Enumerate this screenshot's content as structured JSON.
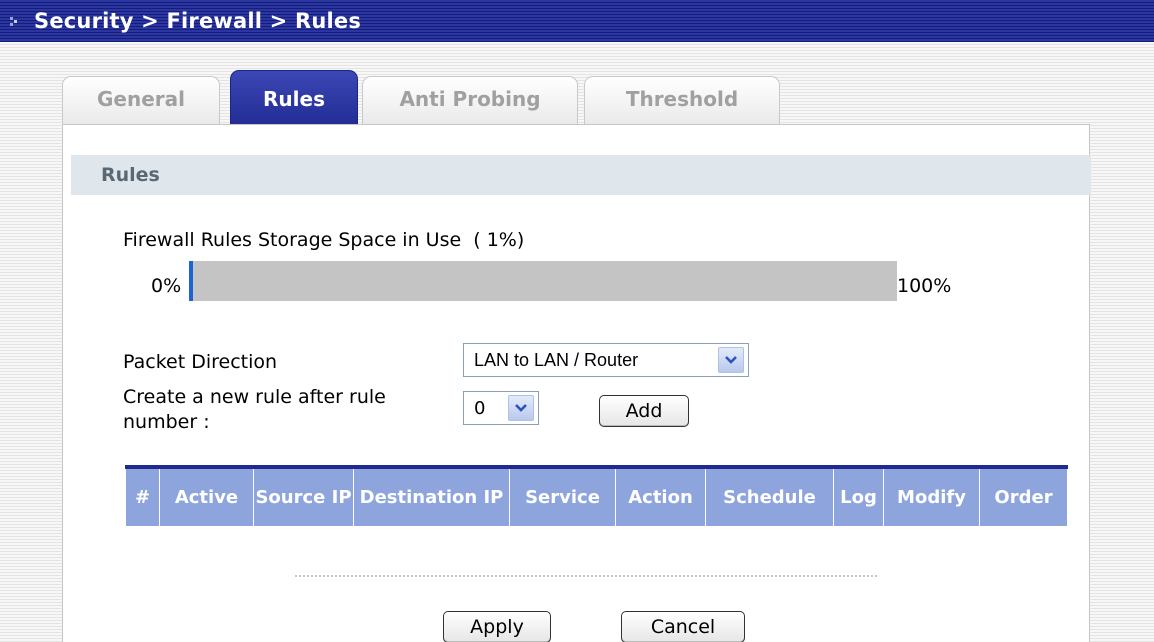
{
  "header": {
    "breadcrumb": "Security > Firewall > Rules"
  },
  "tabs": [
    {
      "label": "General",
      "active": false
    },
    {
      "label": "Rules",
      "active": true
    },
    {
      "label": "Anti Probing",
      "active": false
    },
    {
      "label": "Threshold",
      "active": false
    }
  ],
  "section": {
    "title": "Rules"
  },
  "storage": {
    "label": "Firewall Rules Storage Space in Use  ( 1%)",
    "min_label": "0%",
    "max_label": "100%",
    "used_percent": 1,
    "fill_color": "#1b63d8"
  },
  "form": {
    "packet_direction_label": "Packet Direction",
    "packet_direction_value": "LAN to LAN / Router",
    "new_rule_label": "Create a new rule after rule number :",
    "new_rule_value": "0",
    "add_label": "Add"
  },
  "table": {
    "headers": [
      "#",
      "Active",
      "Source IP",
      "Destination IP",
      "Service",
      "Action",
      "Schedule",
      "Log",
      "Modify",
      "Order"
    ],
    "header_color": "#8ea4dd"
  },
  "footer": {
    "apply_label": "Apply",
    "cancel_label": "Cancel"
  },
  "colors": {
    "title_bar": "#1f2a8e",
    "active_tab": "#2b36a0"
  },
  "icons": {
    "title": "arrow-right-icon",
    "dropdown": "chevron-down-icon"
  }
}
